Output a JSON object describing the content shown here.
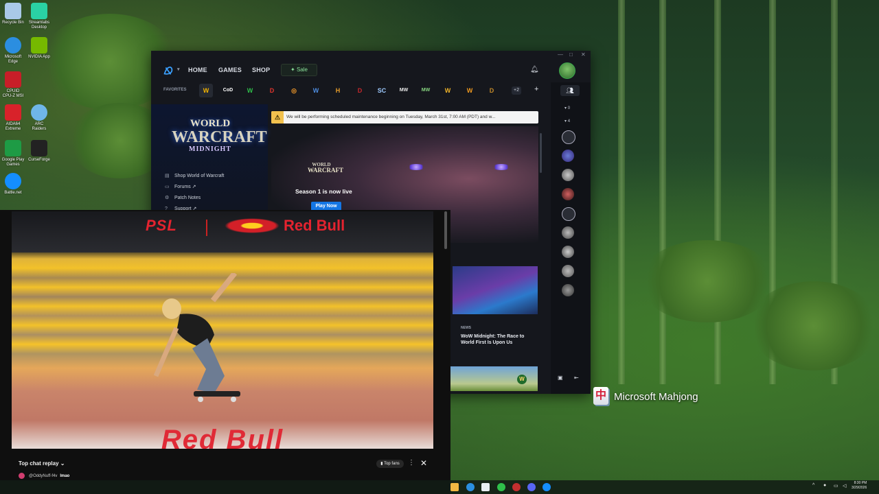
{
  "desktop": {
    "icons": [
      {
        "label": "Recycle Bin",
        "color": "#a9c9e8"
      },
      {
        "label": "Streamlabs Desktop",
        "color": "#2ad1a4"
      },
      {
        "label": "Microsoft Edge",
        "color": "#2b8ee0"
      },
      {
        "label": "NVIDIA App",
        "color": "#76b900"
      },
      {
        "label": "CPUID CPU-Z MSI",
        "color": "#c81e28"
      },
      {
        "label": "AIDA64 Extreme",
        "color": "#d8222a"
      },
      {
        "label": "ARC Raiders",
        "color": "#6fb6e8"
      },
      {
        "label": "Google Play Games",
        "color": "#1e9b45"
      },
      {
        "label": "CurseForge",
        "color": "#222222"
      },
      {
        "label": "Battle.net",
        "color": "#148eff"
      }
    ]
  },
  "bnet": {
    "nav": {
      "home": "HOME",
      "games": "GAMES",
      "shop": "SHOP",
      "sale": "Sale"
    },
    "favorites_label": "FAVORITES",
    "favorites": [
      {
        "abbr": "W",
        "name": "World of Warcraft",
        "color": "#f4b400"
      },
      {
        "abbr": "CoD",
        "name": "Call of Duty",
        "color": "#ffffff"
      },
      {
        "abbr": "W",
        "name": "WoW Classic",
        "color": "#2fbf4a"
      },
      {
        "abbr": "D",
        "name": "Diablo IV",
        "color": "#e0352d"
      },
      {
        "abbr": "◎",
        "name": "Overwatch 2",
        "color": "#f39a2a"
      },
      {
        "abbr": "W",
        "name": "Warcraft Rumble",
        "color": "#4e8de0"
      },
      {
        "abbr": "H",
        "name": "Hearthstone",
        "color": "#e79d2a"
      },
      {
        "abbr": "D",
        "name": "Diablo III",
        "color": "#c7282c"
      },
      {
        "abbr": "SC",
        "name": "StarCraft",
        "color": "#9ecbff"
      },
      {
        "abbr": "MW",
        "name": "Modern Warfare",
        "color": "#e8e8e8"
      },
      {
        "abbr": "MW",
        "name": "Modern Warfare II",
        "color": "#86d37f"
      },
      {
        "abbr": "W",
        "name": "Warcraft III",
        "color": "#f0b429"
      },
      {
        "abbr": "W",
        "name": "Warcraft",
        "color": "#f29b1f"
      },
      {
        "abbr": "D",
        "name": "Diablo II",
        "color": "#c48a2a"
      }
    ],
    "more_count": "+2",
    "game_title": {
      "line1": "WORLD",
      "line2": "WARCRAFT",
      "line3": "MIDNIGHT"
    },
    "side_links": [
      {
        "icon": "cart-icon",
        "glyph": "🛒",
        "label": "Shop World of Warcraft"
      },
      {
        "icon": "chat-icon",
        "glyph": "💬",
        "label": "Forums ↗"
      },
      {
        "icon": "gear-icon",
        "glyph": "⚙",
        "label": "Patch Notes"
      },
      {
        "icon": "help-icon",
        "glyph": "?",
        "label": "Support ↗"
      }
    ],
    "maintenance": "We will be performing scheduled maintenance beginning on Tuesday, March 31st, 7:00 AM (PDT) and w...",
    "hero": {
      "logo_line1": "WORLD",
      "logo_line2": "WARCRAFT",
      "title": "Season 1 is now live",
      "button": "Play Now"
    },
    "news": {
      "category": "NEWS",
      "title": "WoW Midnight: The Race to World First Is Upon Us"
    },
    "friends": {
      "count1": "0",
      "count2": "4"
    }
  },
  "video": {
    "banner_left": "PSL",
    "banner_right": "Red Bull",
    "floor_text": "Red Bull",
    "chat": {
      "title": "Top chat replay",
      "filter": "Top fans",
      "message_user": "@OddyNuff-f4v",
      "message_text": "lmao"
    }
  },
  "mahjong_label": "Microsoft Mahjong",
  "taskbar": {
    "time": "8:30 PM",
    "date": "3/29/2026"
  },
  "colors": {
    "bnet_bg": "#15171d",
    "accent_blue": "#1476e5",
    "sale_green": "#8be39b",
    "redbull_red": "#e4232f"
  }
}
